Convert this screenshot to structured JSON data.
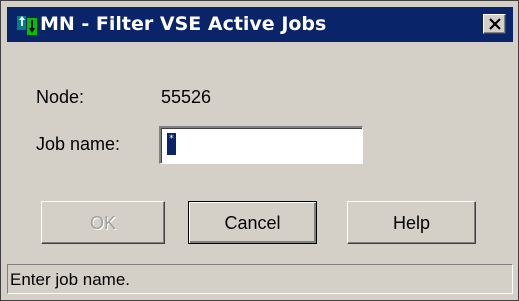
{
  "window": {
    "title": "MN - Filter VSE Active Jobs",
    "icon": "app-icon",
    "close_icon": "close-icon"
  },
  "form": {
    "node_label": "Node:",
    "node_value": "55526",
    "job_label": "Job name:",
    "job_value": "*"
  },
  "buttons": {
    "ok": "OK",
    "cancel": "Cancel",
    "help": "Help",
    "ok_enabled": false
  },
  "status": {
    "text": "Enter job name."
  },
  "colors": {
    "titlebar": "#0a246a",
    "face": "#d4d0c8",
    "selection": "#0a246a"
  }
}
